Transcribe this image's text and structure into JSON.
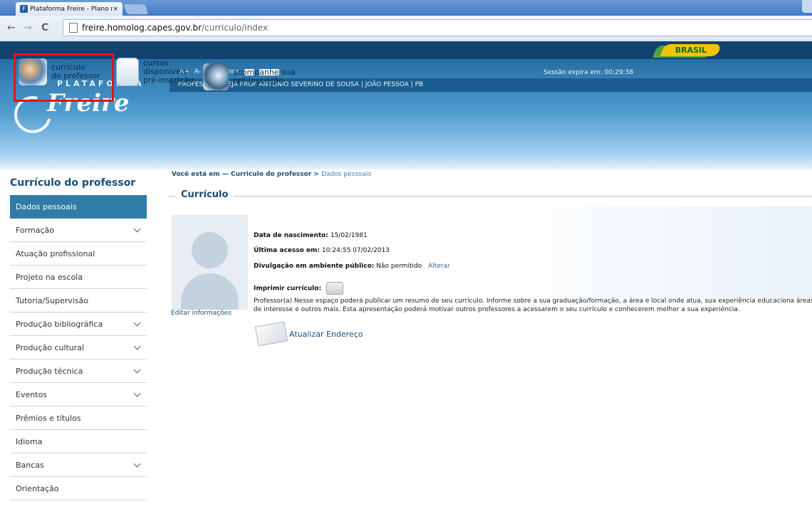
{
  "browser": {
    "tab_title": "Plataforma Freire - Plano nac",
    "tab_close": "×",
    "url_host": "freire.homolog.capes.gov.br",
    "url_path": "/curriculo/index"
  },
  "gov_bar": {
    "badge": "BRASIL"
  },
  "header": {
    "logo_top": "PLATAFORMA",
    "logo_main": "Freire",
    "tools": [
      "A+",
      "A-",
      "A",
      "Atalhos"
    ],
    "session": "Sessão expira em: 00:29:38",
    "info_line": "PROFESSOR | CEJA PROF ANTONIO SEVERINO DE SOUSA | JOÃO PESSOA | PB"
  },
  "shortcuts": [
    {
      "line1": "currículo",
      "line2": "do professor",
      "icon": "teacher-icon"
    },
    {
      "line1": "cursos",
      "line2": "disponíveis",
      "line3": "pré-inscrição",
      "icon": "book-icon"
    },
    {
      "line1": "acompanhe sua",
      "line2": "pré-inscrição",
      "icon": "magnifier-icon"
    }
  ],
  "sidebar": {
    "title": "Currículo do professor",
    "items": [
      {
        "label": "Dados pessoais",
        "active": true,
        "expandable": false
      },
      {
        "label": "Formação",
        "expandable": true
      },
      {
        "label": "Atuação profissional",
        "expandable": false
      },
      {
        "label": "Projeto na escola",
        "expandable": false
      },
      {
        "label": "Tutoria/Supervisão",
        "expandable": false
      },
      {
        "label": "Produção bibliográfica",
        "expandable": true
      },
      {
        "label": "Produção cultural",
        "expandable": true
      },
      {
        "label": "Produção técnica",
        "expandable": true
      },
      {
        "label": "Eventos",
        "expandable": true
      },
      {
        "label": "Prêmios e títulos",
        "expandable": false
      },
      {
        "label": "Idioma",
        "expandable": false
      },
      {
        "label": "Bancas",
        "expandable": true
      },
      {
        "label": "Orientação",
        "expandable": false
      }
    ]
  },
  "breadcrumb": {
    "prefix": "Você está em",
    "dash": "—",
    "parent": "Curriculo do professor",
    "sep": ">",
    "current": "Dados pessoais"
  },
  "main": {
    "section_title": "Currículo",
    "edit_link": "Editar informações",
    "birth_label": "Data de nascimento:",
    "birth_value": "15/02/1981",
    "access_label": "Última acesso em:",
    "access_value": "10:24:55 07/02/2013",
    "privacy_label": "Divulgação em ambiente público:",
    "privacy_value": "Não permitido",
    "privacy_link": "Alterar",
    "print_label": "Imprimir currículo:",
    "description": "Professor(a) Nesse espaço poderá publicar um resumo de seu currículo. Informe sobre a sua graduação/formação, a área e local onde atua, sua experiência educaciona áreas de interesse e outros mais. Esta apresentação poderá motivar outros professores a acessarem o seu currículo e conhecerem melhor a sua experiência.",
    "update_address": "Atualizar Endereço"
  }
}
